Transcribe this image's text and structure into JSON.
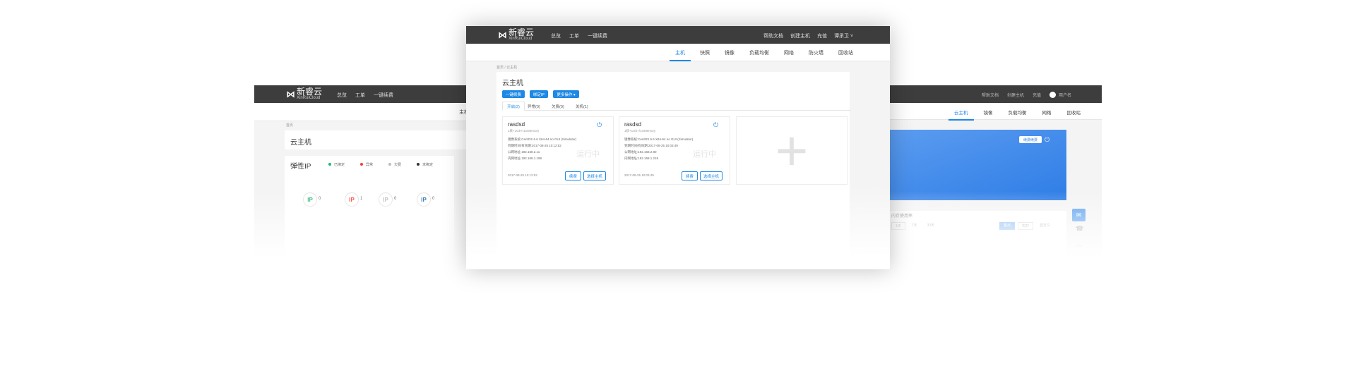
{
  "left": {
    "logo": {
      "mark": "⋈",
      "cn": "新睿云",
      "en": "XinRuiCloud"
    },
    "nav": [
      "总览",
      "工单",
      "一键续费"
    ],
    "breadcrumb": "首页",
    "page_title": "云主机",
    "subnav_partial": "主机",
    "eip": {
      "title": "弹性IP",
      "legend": [
        {
          "label": "已绑定",
          "color": "#22b573"
        },
        {
          "label": "异常",
          "color": "#ff3b30"
        },
        {
          "label": "欠费",
          "color": "#bbbbbb"
        },
        {
          "label": "未绑定",
          "color": "#333333"
        }
      ],
      "stats": [
        {
          "label": "IP",
          "count": "0",
          "color": "#22b573"
        },
        {
          "label": "IP",
          "count": "1",
          "color": "#ff3b30"
        },
        {
          "label": "IP",
          "count": "0",
          "color": "#bbbbbb"
        },
        {
          "label": "IP",
          "count": "0",
          "color": "#1e6aa8"
        }
      ]
    }
  },
  "center": {
    "logo": {
      "mark": "⋈",
      "cn": "新睿云",
      "en": "XinRuiCloud"
    },
    "nav": [
      "总览",
      "工单",
      "一键续费"
    ],
    "nav_right": [
      "帮助文档",
      "创建主机",
      "充值",
      "谭承卫"
    ],
    "subnav": [
      "主机",
      "快照",
      "镜像",
      "负载均衡",
      "网络",
      "防火墙",
      "回收站"
    ],
    "breadcrumb": "首页 / 云主机",
    "page_title": "云主机",
    "actions": [
      "一键续费",
      "绑定IP",
      "更多操作 ▾"
    ],
    "tabs": [
      "开启(2)",
      "异常(0)",
      "欠费(0)",
      "关机(1)"
    ],
    "hosts": [
      {
        "name": "rasdsd",
        "spec": "1核+1Gb+/1GMemory",
        "lines": [
          "镜像系统:CentOS 6.6 X64-64 no GUI (Simulator)",
          "到期时间/有效期:2017-08-25 10:12:52",
          "公网地址:192.168.2.11",
          "内网地址:192.168.1.198"
        ],
        "status": "运行中",
        "date": "2017-08-25 10:12:52",
        "btn_renew": "续费",
        "btn_select": "选择主机"
      },
      {
        "name": "rasdsd",
        "spec": "1核+1Gb+/1GMemory",
        "lines": [
          "镜像系统:CentOS 6.6 X64-64 no GUI (Simulator)",
          "到期时间/有效期:2017-08-25 10:03:49",
          "公网地址:192.168.2.80",
          "内网地址:192.168.1.219"
        ],
        "status": "运行中",
        "date": "2017-08-25 10:03:49",
        "btn_renew": "续费",
        "btn_select": "选择主机"
      }
    ],
    "add_glyph": "+"
  },
  "right": {
    "nav_right": [
      "帮助文档",
      "创建主机",
      "充值",
      "用户名"
    ],
    "subnav": [
      "云主机",
      "镜像",
      "负载均衡",
      "网络",
      "回收站"
    ],
    "banner_button": "续费续费",
    "chart_title": "内存使用率",
    "chart_tabs_left": [
      "1天",
      "7天",
      "30天"
    ],
    "chart_tabs_right": [
      "整点",
      "实时",
      "自定义"
    ]
  }
}
